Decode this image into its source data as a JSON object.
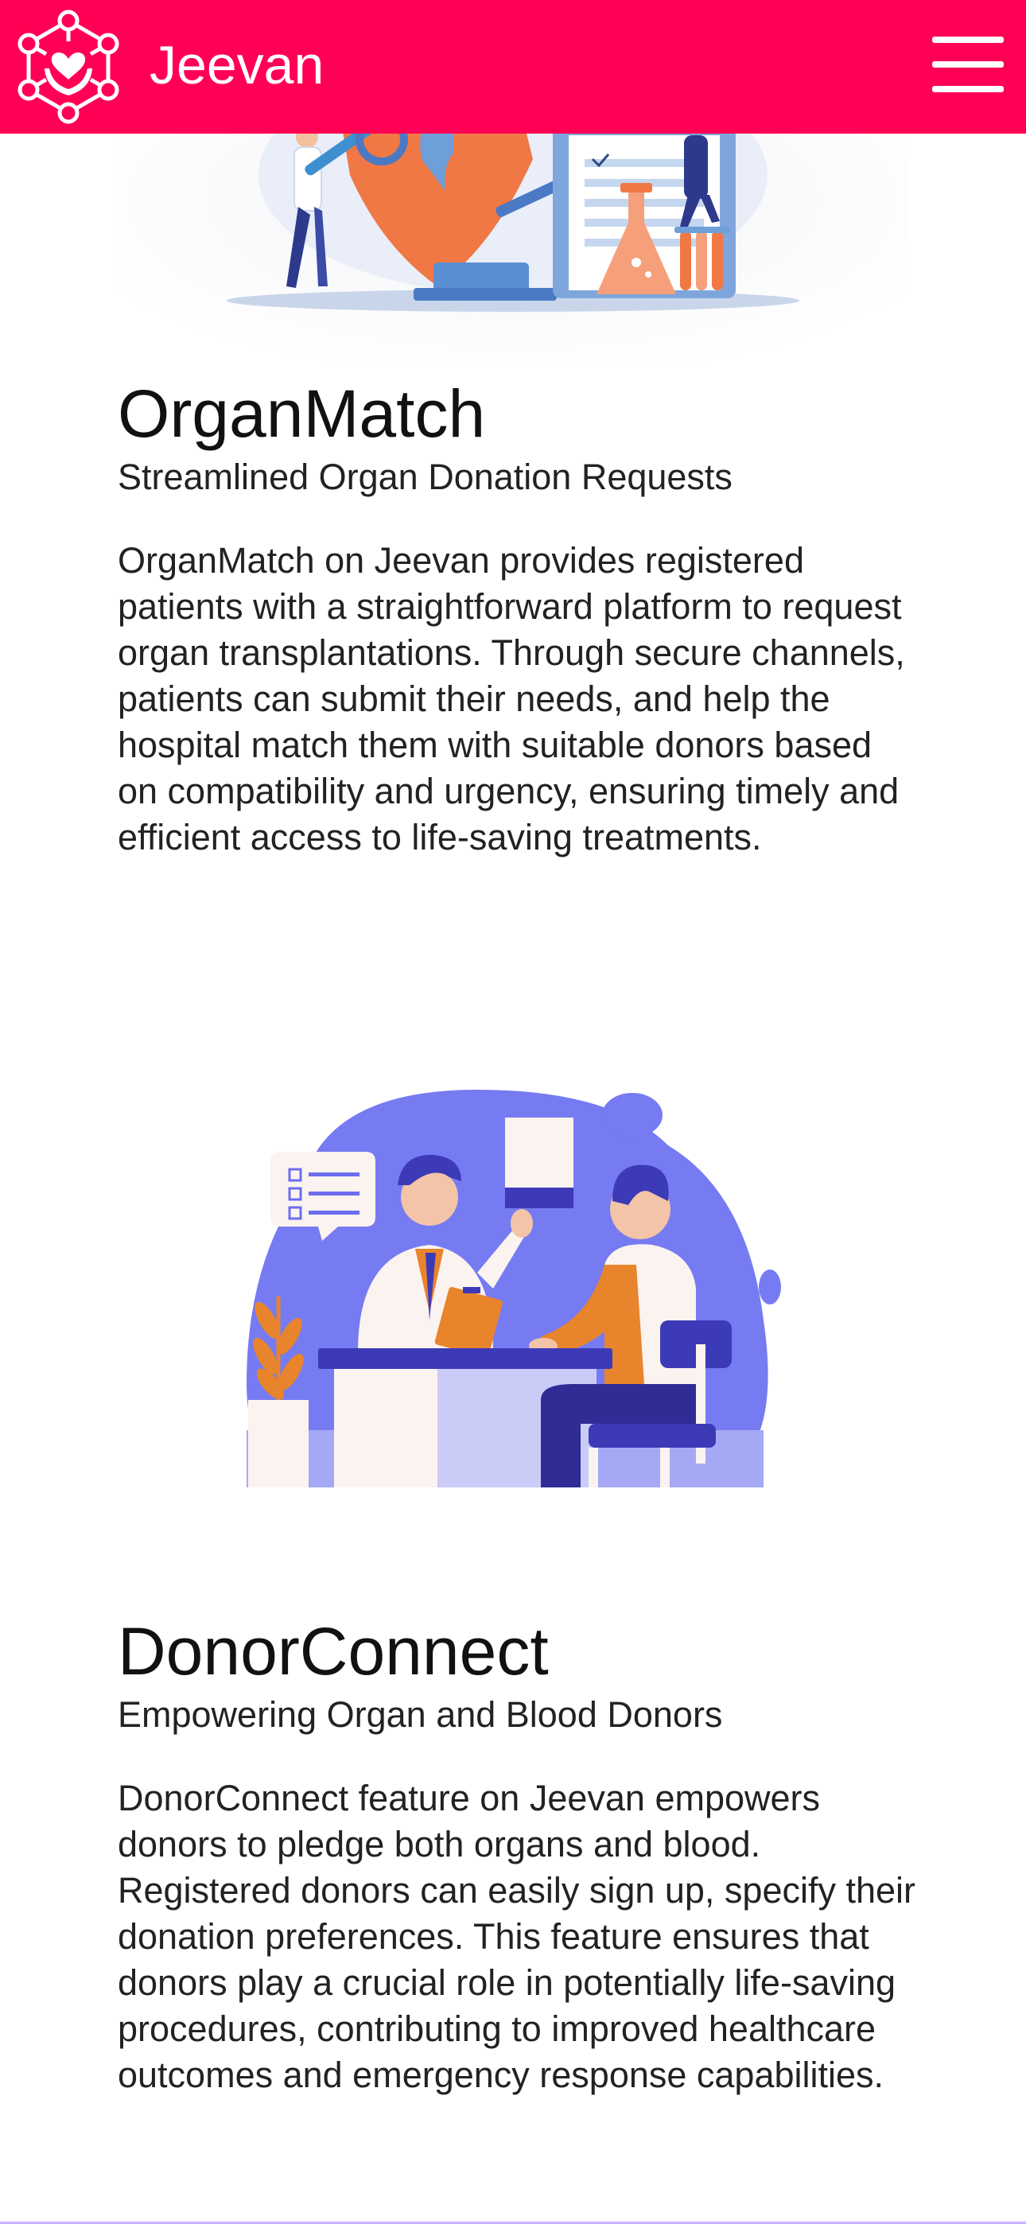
{
  "header": {
    "brand": "Jeevan",
    "logo_icon": "heart-in-hands-network-icon",
    "menu_icon": "hamburger-menu-icon",
    "background_color": "#ff0055"
  },
  "features": [
    {
      "title": "OrganMatch",
      "subtitle": "Streamlined Organ Donation Requests",
      "description": "OrganMatch on Jeevan provides registered patients with a straightforward platform to request organ transplantations. Through secure channels, patients can submit their needs, and help the hospital match them with suitable donors based on compatibility and urgency, ensuring timely and efficient access to life-saving treatments.",
      "illustration": "medical-lab-research-illustration"
    },
    {
      "title": "DonorConnect",
      "subtitle": "Empowering Organ and Blood Donors",
      "description": "DonorConnect feature on Jeevan empowers donors to pledge both organs and blood. Registered donors can easily sign up, specify their donation preferences. This feature ensures that donors play a crucial role in potentially life-saving procedures, contributing to improved healthcare outcomes and emergency response capabilities.",
      "illustration": "doctor-patient-consultation-illustration"
    }
  ],
  "colors": {
    "accent": "#ff0055",
    "illustration_purple": "#6c6ef0",
    "illustration_orange": "#e8842c",
    "illustration_blue": "#6ba3df"
  }
}
